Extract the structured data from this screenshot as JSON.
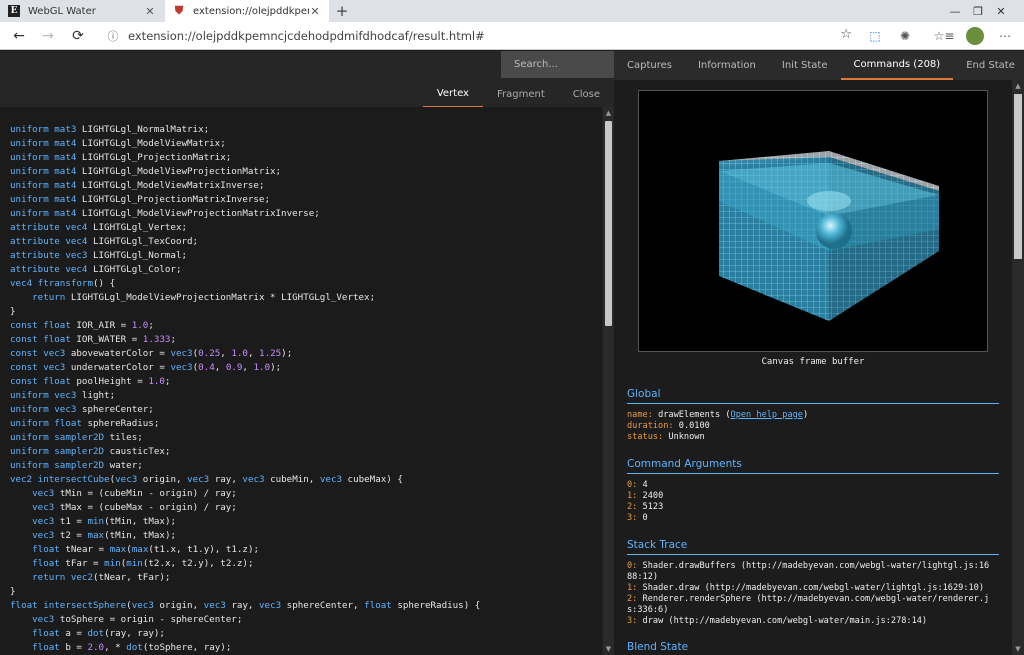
{
  "browser": {
    "tabs": [
      {
        "title": "WebGL Water",
        "favicon": "E"
      },
      {
        "title": "extension://olejpddkpemncjcdel",
        "favicon": "shield"
      }
    ],
    "url": "extension://olejpddkpemncjcdehodpdmifdhodcaf/result.html#",
    "icons": {
      "back": "←",
      "forward": "→",
      "reload": "⟳",
      "newtab": "+",
      "close": "✕",
      "minimize": "—",
      "maximize": "❐",
      "star": "☆",
      "info": "ⓘ",
      "favorites": "☆≡",
      "ext1": "⬚",
      "ext2": "✺"
    }
  },
  "search": {
    "placeholder": "Search...",
    "clear": "x"
  },
  "code_tabs": [
    "Vertex",
    "Fragment",
    "Close"
  ],
  "code_lines": [
    [
      [
        "kw",
        "uniform mat3 "
      ],
      [
        "",
        "LIGHTGLgl_NormalMatrix;"
      ]
    ],
    [
      [
        "kw",
        "uniform mat4 "
      ],
      [
        "",
        "LIGHTGLgl_ModelViewMatrix;"
      ]
    ],
    [
      [
        "kw",
        "uniform mat4 "
      ],
      [
        "",
        "LIGHTGLgl_ProjectionMatrix;"
      ]
    ],
    [
      [
        "kw",
        "uniform mat4 "
      ],
      [
        "",
        "LIGHTGLgl_ModelViewProjectionMatrix;"
      ]
    ],
    [
      [
        "kw",
        "uniform mat4 "
      ],
      [
        "",
        "LIGHTGLgl_ModelViewMatrixInverse;"
      ]
    ],
    [
      [
        "kw",
        "uniform mat4 "
      ],
      [
        "",
        "LIGHTGLgl_ProjectionMatrixInverse;"
      ]
    ],
    [
      [
        "kw",
        "uniform mat4 "
      ],
      [
        "",
        "LIGHTGLgl_ModelViewProjectionMatrixInverse;"
      ]
    ],
    [
      [
        "kw",
        "attribute vec4 "
      ],
      [
        "",
        "LIGHTGLgl_Vertex;"
      ]
    ],
    [
      [
        "kw",
        "attribute vec4 "
      ],
      [
        "",
        "LIGHTGLgl_TexCoord;"
      ]
    ],
    [
      [
        "kw",
        "attribute vec3 "
      ],
      [
        "",
        "LIGHTGLgl_Normal;"
      ]
    ],
    [
      [
        "kw",
        "attribute vec4 "
      ],
      [
        "",
        "LIGHTGLgl_Color;"
      ]
    ],
    [
      [
        "kw",
        "vec4 ftransform"
      ],
      [
        "",
        "() {"
      ]
    ],
    [
      [
        "",
        "    "
      ],
      [
        "kw",
        "return "
      ],
      [
        "",
        "LIGHTGLgl_ModelViewProjectionMatrix * LIGHTGLgl_Vertex;"
      ]
    ],
    [
      [
        "",
        "}"
      ]
    ],
    [
      [
        "kw",
        "const float "
      ],
      [
        "",
        "IOR_AIR = "
      ],
      [
        "num",
        "1.0"
      ],
      [
        "",
        ";"
      ]
    ],
    [
      [
        "kw",
        "const float "
      ],
      [
        "",
        "IOR_WATER = "
      ],
      [
        "num",
        "1.333"
      ],
      [
        "",
        ";"
      ]
    ],
    [
      [
        "kw",
        "const vec3 "
      ],
      [
        "",
        "abovewaterColor = "
      ],
      [
        "kw",
        "vec3"
      ],
      [
        "",
        "("
      ],
      [
        "num",
        "0.25"
      ],
      [
        "",
        ", "
      ],
      [
        "num",
        "1.0"
      ],
      [
        "",
        ", "
      ],
      [
        "num",
        "1.25"
      ],
      [
        "",
        "); "
      ]
    ],
    [
      [
        "kw",
        "const vec3 "
      ],
      [
        "",
        "underwaterColor = "
      ],
      [
        "kw",
        "vec3"
      ],
      [
        "",
        "("
      ],
      [
        "num",
        "0.4"
      ],
      [
        "",
        ", "
      ],
      [
        "num",
        "0.9"
      ],
      [
        "",
        ", "
      ],
      [
        "num",
        "1.0"
      ],
      [
        "",
        "); "
      ]
    ],
    [
      [
        "kw",
        "const float "
      ],
      [
        "",
        "poolHeight = "
      ],
      [
        "num",
        "1.0"
      ],
      [
        "",
        ";"
      ]
    ],
    [
      [
        "kw",
        "uniform vec3 "
      ],
      [
        "",
        "light;"
      ]
    ],
    [
      [
        "kw",
        "uniform vec3 "
      ],
      [
        "",
        "sphereCenter;"
      ]
    ],
    [
      [
        "kw",
        "uniform float "
      ],
      [
        "",
        "sphereRadius;"
      ]
    ],
    [
      [
        "kw",
        "uniform sampler2D "
      ],
      [
        "",
        "tiles;"
      ]
    ],
    [
      [
        "kw",
        "uniform sampler2D "
      ],
      [
        "",
        "causticTex;"
      ]
    ],
    [
      [
        "kw",
        "uniform sampler2D "
      ],
      [
        "",
        "water;"
      ]
    ],
    [
      [
        "kw",
        "vec2 intersectCube"
      ],
      [
        "",
        "("
      ],
      [
        "kw",
        "vec3 "
      ],
      [
        "",
        "origin, "
      ],
      [
        "kw",
        "vec3 "
      ],
      [
        "",
        "ray, "
      ],
      [
        "kw",
        "vec3 "
      ],
      [
        "",
        "cubeMin, "
      ],
      [
        "kw",
        "vec3 "
      ],
      [
        "",
        "cubeMax) {"
      ]
    ],
    [
      [
        "",
        "    "
      ],
      [
        "kw",
        "vec3 "
      ],
      [
        "",
        "tMin = (cubeMin - origin) / ray;"
      ]
    ],
    [
      [
        "",
        "    "
      ],
      [
        "kw",
        "vec3 "
      ],
      [
        "",
        "tMax = (cubeMax - origin) / ray;"
      ]
    ],
    [
      [
        "",
        "    "
      ],
      [
        "kw",
        "vec3 "
      ],
      [
        "",
        "t1 = "
      ],
      [
        "kw",
        "min"
      ],
      [
        "",
        "(tMin, tMax);"
      ]
    ],
    [
      [
        "",
        "    "
      ],
      [
        "kw",
        "vec3 "
      ],
      [
        "",
        "t2 = "
      ],
      [
        "kw",
        "max"
      ],
      [
        "",
        "(tMin, tMax);"
      ]
    ],
    [
      [
        "",
        "    "
      ],
      [
        "kw",
        "float "
      ],
      [
        "",
        "tNear = "
      ],
      [
        "kw",
        "max"
      ],
      [
        "",
        "("
      ],
      [
        "kw",
        "max"
      ],
      [
        "",
        "(t1.x, t1.y), t1.z);"
      ]
    ],
    [
      [
        "",
        "    "
      ],
      [
        "kw",
        "float "
      ],
      [
        "",
        "tFar = "
      ],
      [
        "kw",
        "min"
      ],
      [
        "",
        "("
      ],
      [
        "kw",
        "min"
      ],
      [
        "",
        "(t2.x, t2.y), t2.z);"
      ]
    ],
    [
      [
        "",
        "    "
      ],
      [
        "kw",
        "return vec2"
      ],
      [
        "",
        "(tNear, tFar);"
      ]
    ],
    [
      [
        "",
        "}"
      ]
    ],
    [
      [
        "kw",
        "float intersectSphere"
      ],
      [
        "",
        "("
      ],
      [
        "kw",
        "vec3 "
      ],
      [
        "",
        "origin, "
      ],
      [
        "kw",
        "vec3 "
      ],
      [
        "",
        "ray, "
      ],
      [
        "kw",
        "vec3 "
      ],
      [
        "",
        "sphereCenter, "
      ],
      [
        "kw",
        "float "
      ],
      [
        "",
        "sphereRadius) {"
      ]
    ],
    [
      [
        "",
        "    "
      ],
      [
        "kw",
        "vec3 "
      ],
      [
        "",
        "toSphere = origin - sphereCenter;"
      ]
    ],
    [
      [
        "",
        "    "
      ],
      [
        "kw",
        "float "
      ],
      [
        "",
        "a = "
      ],
      [
        "kw",
        "dot"
      ],
      [
        "",
        "(ray, ray);"
      ]
    ],
    [
      [
        "",
        "    "
      ],
      [
        "kw",
        "float "
      ],
      [
        "",
        "b = "
      ],
      [
        "num",
        "2.0"
      ],
      [
        "",
        ", * "
      ],
      [
        "kw",
        "dot"
      ],
      [
        "",
        "(toSphere, ray);"
      ]
    ]
  ],
  "inspector_tabs": [
    {
      "label": "Captures"
    },
    {
      "label": "Information"
    },
    {
      "label": "Init State"
    },
    {
      "label": "Commands (208)",
      "active": true
    },
    {
      "label": "End State"
    }
  ],
  "canvas_caption": "Canvas frame buffer",
  "global": {
    "title": "Global",
    "name_key": "name:",
    "name_value": "drawElements",
    "help_open": "(",
    "help_link": "Open help page",
    "help_close": ")",
    "duration_key": "duration:",
    "duration_value": "0.0100",
    "status_key": "status:",
    "status_value": "Unknown"
  },
  "command_arguments": {
    "title": "Command Arguments",
    "items": [
      {
        "key": "0:",
        "value": "4"
      },
      {
        "key": "1:",
        "value": "2400"
      },
      {
        "key": "2:",
        "value": "5123"
      },
      {
        "key": "3:",
        "value": "0"
      }
    ]
  },
  "stack_trace": {
    "title": "Stack Trace",
    "items": [
      {
        "key": "0:",
        "lines": [
          "Shader.drawBuffers (http://madebyevan.com/webgl-water/lightgl.js:16",
          "88:12)"
        ]
      },
      {
        "key": "1:",
        "lines": [
          "Shader.draw (http://madebyevan.com/webgl-water/lightgl.js:1629:10)"
        ]
      },
      {
        "key": "2:",
        "lines": [
          "Renderer.renderSphere (http://madebyevan.com/webgl-water/renderer.j",
          "s:336:6)"
        ]
      },
      {
        "key": "3:",
        "lines": [
          "draw (http://madebyevan.com/webgl-water/main.js:278:14)"
        ]
      }
    ]
  },
  "blend_state": {
    "title": "Blend State"
  },
  "colors": {
    "accent": "#e07a3a",
    "keyword": "#5fb3ff",
    "number": "#c88cff",
    "key": "#e89a3c",
    "water": "#3aa7c9"
  }
}
